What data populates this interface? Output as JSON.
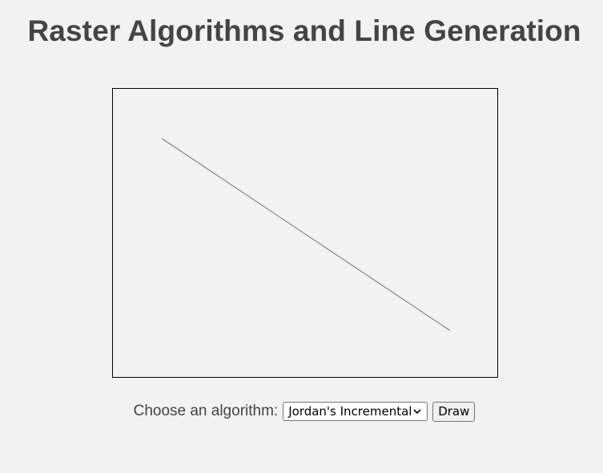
{
  "page": {
    "title": "Raster Algorithms and Line Generation"
  },
  "canvas": {
    "line_color": "#808080",
    "border_color": "#000000"
  },
  "controls": {
    "label": "Choose an algorithm:",
    "algorithm_select": {
      "selected": "Jordan's Incremental"
    },
    "draw_button_label": "Draw"
  },
  "colors": {
    "background": "#f2f2f2",
    "text": "#444444"
  }
}
